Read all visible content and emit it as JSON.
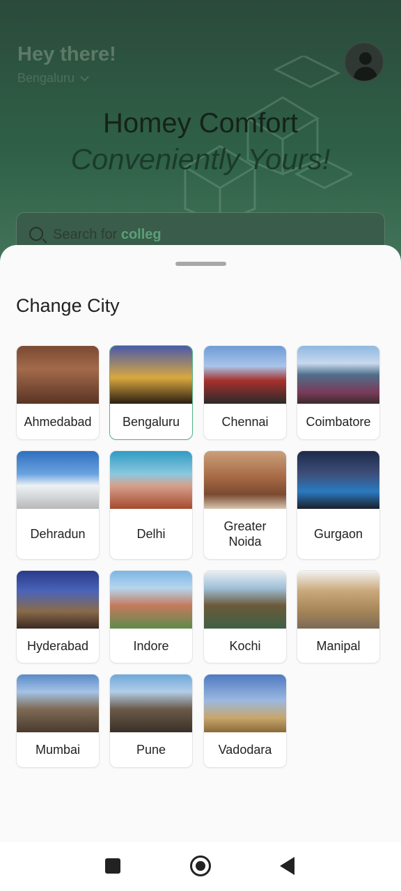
{
  "background_screen": {
    "greeting": "Hey there!",
    "selected_city": "Bengaluru",
    "hero_line1": "Homey Comfort",
    "hero_line2": "Conveniently Yours!",
    "search_prefix": "Search for",
    "search_highlight": "colleg"
  },
  "sheet": {
    "title": "Change City",
    "cities": [
      {
        "label": "Ahmedabad",
        "selected": false
      },
      {
        "label": "Bengaluru",
        "selected": true
      },
      {
        "label": "Chennai",
        "selected": false
      },
      {
        "label": "Coimbatore",
        "selected": false
      },
      {
        "label": "Dehradun",
        "selected": false
      },
      {
        "label": "Delhi",
        "selected": false
      },
      {
        "label": "Greater Noida",
        "selected": false
      },
      {
        "label": "Gurgaon",
        "selected": false
      },
      {
        "label": "Hyderabad",
        "selected": false
      },
      {
        "label": "Indore",
        "selected": false
      },
      {
        "label": "Kochi",
        "selected": false
      },
      {
        "label": "Manipal",
        "selected": false
      },
      {
        "label": "Mumbai",
        "selected": false
      },
      {
        "label": "Pune",
        "selected": false
      },
      {
        "label": "Vadodara",
        "selected": false
      }
    ]
  },
  "colors": {
    "accent": "#4fb58b",
    "overlay": "#2f6248"
  },
  "navbar": {
    "icons": [
      "recents-icon",
      "home-icon",
      "back-icon"
    ]
  }
}
